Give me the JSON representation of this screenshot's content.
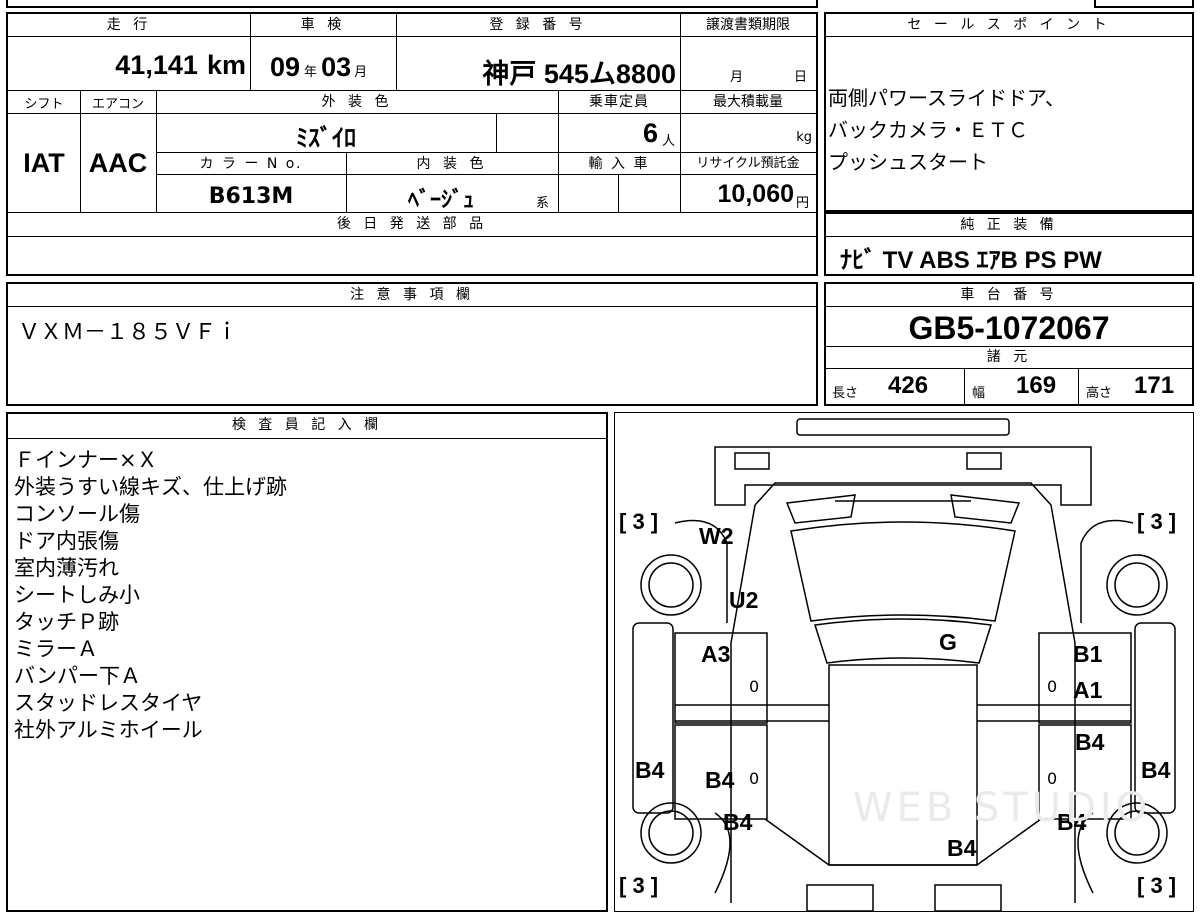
{
  "vehicle": {
    "mileage_label": "走 行",
    "mileage_value": "41,141",
    "mileage_unit": "km",
    "inspection_label": "車 検",
    "inspection_year": "09",
    "inspection_year_unit": "年",
    "inspection_month": "03",
    "inspection_month_unit": "月",
    "registration_label": "登 録 番 号",
    "registration_value": "神戸 545ム8800",
    "transfer_label": "譲渡書類期限",
    "transfer_month_unit": "月",
    "transfer_day_unit": "日",
    "shift_label": "シフト",
    "shift_value": "IAT",
    "aircon_label": "エアコン",
    "aircon_value": "AAC",
    "exterior_label": "外 装 色",
    "exterior_value": "ﾐｽﾞｲﾛ",
    "capacity_label": "乗車定員",
    "capacity_value": "6",
    "capacity_unit": "人",
    "max_load_label": "最大積載量",
    "max_load_unit": "kg",
    "color_no_label": "カ ラ ー N o.",
    "color_no_value": "B613M",
    "interior_label": "内 装 色",
    "interior_value": "ﾍﾞｰｼﾞｭ",
    "interior_suffix": "系",
    "import_label": "輸 入 車",
    "recycle_label": "リサイクル預託金",
    "recycle_value": "10,060",
    "recycle_unit": "円",
    "later_parts_label": "後 日 発 送 部 品"
  },
  "sales_point": {
    "label": "セ ー ル ス ポ イ ン ト",
    "lines": [
      "両側パワースライドドア、",
      "バックカメラ・ＥＴＣ",
      "プッシュスタート"
    ]
  },
  "equipment": {
    "label": "純 正 装 備",
    "value": "ﾅﾋﾞ TV ABS ｴｱB PS PW"
  },
  "notes": {
    "label": "注 意 事 項 欄",
    "value": "ＶＸＭ－１８５ＶＦｉ"
  },
  "chassis": {
    "label": "車 台 番 号",
    "value": "GB5-1072067",
    "spec_label": "諸 元",
    "length_label": "長さ",
    "length_value": "426",
    "width_label": "幅",
    "width_value": "169",
    "height_label": "高さ",
    "height_value": "171"
  },
  "inspector": {
    "label": "検 査 員 記 入 欄",
    "lines": [
      "Ｆインナー×Ｘ",
      "外装うすい線キズ、仕上げ跡",
      "コンソール傷",
      "ドア内張傷",
      "室内薄汚れ",
      "シートしみ小",
      "タッチＰ跡",
      "ミラーＡ",
      "バンパー下Ａ",
      "スタッドレスタイヤ",
      "社外アルミホイール"
    ]
  },
  "diagram": {
    "tire_marks": [
      "[ 3 ]",
      "[ 3 ]",
      "[ 3 ]",
      "[ 3 ]"
    ],
    "marks": {
      "w2": "W2",
      "u2": "U2",
      "g": "G",
      "a3": "A3",
      "b1": "B1",
      "a1": "A1",
      "b4_right_door": "B4",
      "b4_left_fender": "B4",
      "b4_left_door": "B4",
      "b4_right_fender": "B4",
      "b4_left_rear": "B4",
      "b4_right_rear": "B4",
      "b4_rear": "B4"
    },
    "zero_marks": [
      "0",
      "0",
      "0",
      "0"
    ],
    "watermark": "WEB STUDIO"
  }
}
